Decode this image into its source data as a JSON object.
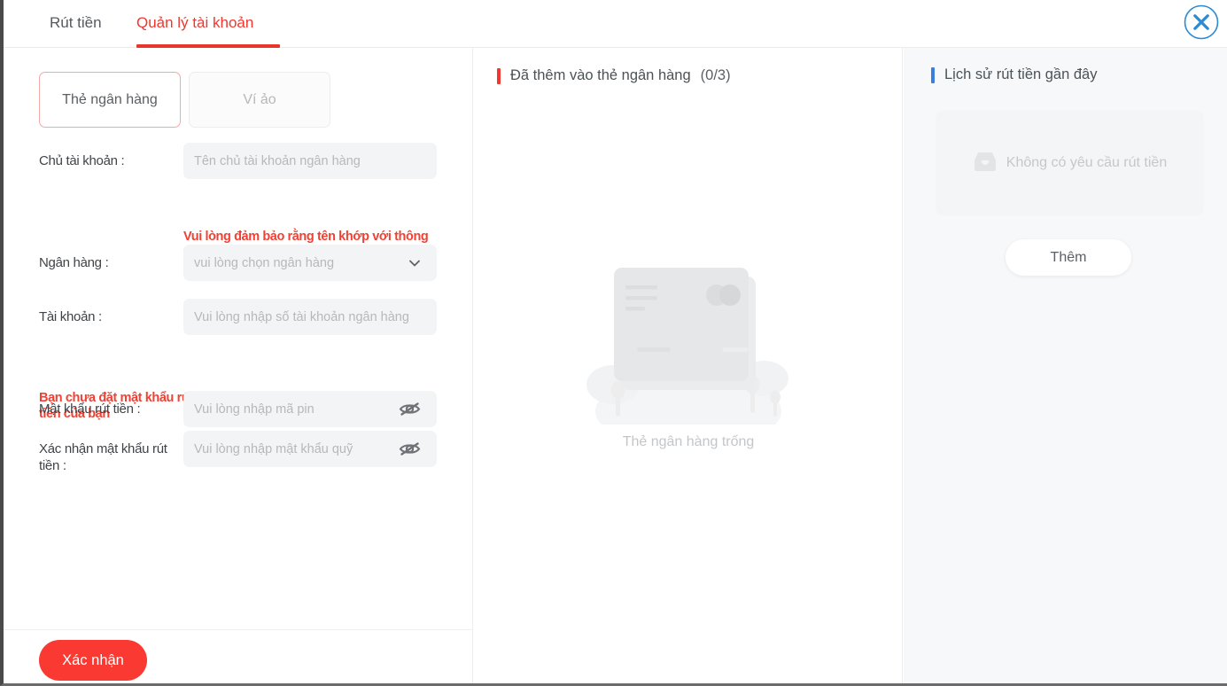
{
  "colors": {
    "accent_red": "#f0372e",
    "accent_blue": "#3a7fe0",
    "close_blue": "#2b8ad4",
    "confirm_red": "#fa3a32",
    "scroll_thumb_blue": "#1a90e8"
  },
  "tabs": [
    {
      "label": "Rút tiền",
      "active": false
    },
    {
      "label": "Quản lý tài khoản",
      "active": true
    }
  ],
  "close": {
    "icon": "close-circle-icon"
  },
  "left_panel": {
    "type_buttons": [
      {
        "label": "Thẻ ngân hàng",
        "active": true
      },
      {
        "label": "Ví ảo",
        "active": false
      }
    ],
    "fields": [
      {
        "label": "Chủ tài khoản :",
        "placeholder": "Tên chủ tài khoản ngân hàng",
        "icon": ""
      },
      {
        "label": "Ngân hàng :",
        "placeholder": "vui lòng chọn ngân hàng",
        "icon": "chevron-down-icon"
      },
      {
        "label": "Tài khoản :",
        "placeholder": "Vui lòng nhập số tài khoản ngân hàng",
        "icon": ""
      },
      {
        "label": "Mật khẩu rút tiền :",
        "placeholder": "Vui lòng nhập mã pin",
        "icon": "eye-off-icon"
      },
      {
        "label": "Xác nhận mật khẩu rút tiền :",
        "placeholder": "Vui lòng nhập mật khẩu quỹ",
        "icon": "eye-off-icon"
      }
    ],
    "warnings": [
      "Vui lòng đảm bảo rằng tên khớp với thông tin rút tiền để tránh thất bại.",
      "Bạn chưa đặt mật khẩu rút tiền. Vui lòng đặt mật khẩu rút tiền của bạn"
    ],
    "confirm_label": "Xác nhận"
  },
  "middle_panel": {
    "heading": "Đã thêm vào thẻ ngân hàng",
    "count": "(0/3)",
    "empty_text": "Thẻ ngân hàng trống",
    "empty_icon": "empty-bank-card-illustration"
  },
  "right_panel": {
    "heading": "Lịch sử rút tiền gần đây",
    "empty_text": "Không có yêu cầu rút tiền",
    "empty_icon": "empty-inbox-icon",
    "add_label": "Thêm"
  }
}
